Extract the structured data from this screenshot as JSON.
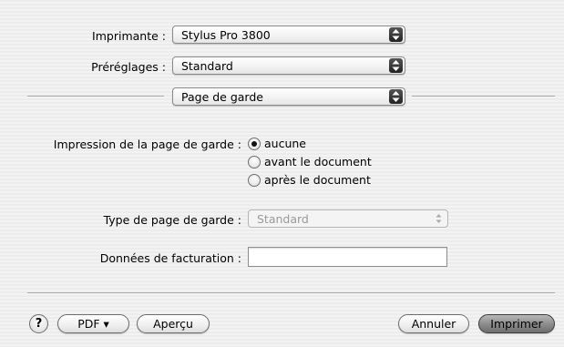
{
  "printer": {
    "label": "Imprimante :",
    "value": "Stylus Pro 3800"
  },
  "presets": {
    "label": "Préréglages :",
    "value": "Standard"
  },
  "panel": {
    "value": "Page de garde"
  },
  "cover_page": {
    "label": "Impression de la page de garde :",
    "options": [
      {
        "label": "aucune",
        "selected": true
      },
      {
        "label": "avant le document",
        "selected": false
      },
      {
        "label": "après le document",
        "selected": false
      }
    ]
  },
  "cover_type": {
    "label": "Type de page de garde :",
    "value": "Standard",
    "enabled": false
  },
  "billing": {
    "label": "Données de facturation :",
    "value": ""
  },
  "footer": {
    "help": "?",
    "pdf": "PDF ▾",
    "preview": "Aperçu",
    "cancel": "Annuler",
    "print": "Imprimer"
  }
}
